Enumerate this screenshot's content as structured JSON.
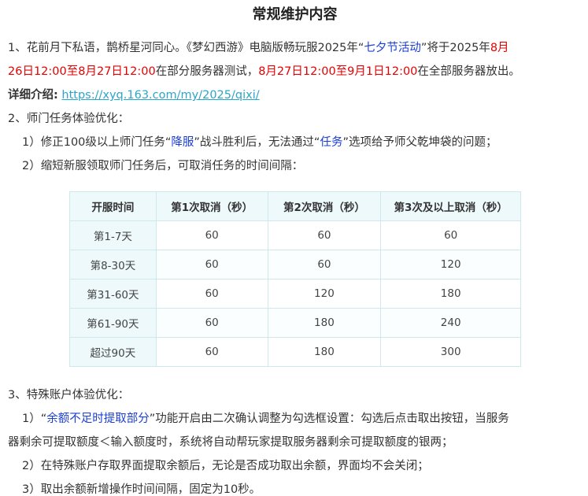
{
  "title": "常规维护内容",
  "item1": {
    "prefix": "1、花前月下私语，鹊桥星河同心。《梦幻西游》电脑版畅玩服2025年“",
    "event_name": "七夕节活动",
    "mid": "”将于2025年",
    "date1a": "8月",
    "date1b": "26日12:00至8月27日12:00",
    "mid2": "在部分服务器测试，",
    "date2": "8月27日12:00至9月1日12:00",
    "suffix": "在全部服务器放出。"
  },
  "detail": {
    "label": "详细介绍:",
    "url": "https://xyq.163.com/my/2025/qixi/"
  },
  "item2": {
    "heading": "2、师门任务体验优化：",
    "sub1_prefix": "1）修正100级以上师门任务“",
    "sub1_k1": "降服",
    "sub1_mid": "”战斗胜利后，无法通过“",
    "sub1_k2": "任务",
    "sub1_suffix": "”选项给予师父乾坤袋的问题；",
    "sub2": "2）缩短新服领取师门任务后，可取消任务的时间间隔："
  },
  "table": {
    "headers": [
      "开服时间",
      "第1次取消（秒）",
      "第2次取消（秒）",
      "第3次及以上取消（秒）"
    ],
    "rows": [
      [
        "第1-7天",
        "60",
        "60",
        "60"
      ],
      [
        "第8-30天",
        "60",
        "60",
        "120"
      ],
      [
        "第31-60天",
        "60",
        "120",
        "180"
      ],
      [
        "第61-90天",
        "60",
        "180",
        "240"
      ],
      [
        "超过90天",
        "60",
        "180",
        "300"
      ]
    ]
  },
  "item3": {
    "heading": "3、特殊账户体验优化：",
    "sub1_prefix": "1）“",
    "sub1_k": "余额不足时提取部分",
    "sub1_suffix": "”功能开启由二次确认调整为勾选框设置：勾选后点击取出按钮，当服务",
    "sub1_line2": "器剩余可提取额度＜输入额度时，系统将自动帮玩家提取服务器剩余可提取额度的银两；",
    "sub2": "2）在特殊账户存取界面提取余额后，无论是否成功取出余额，界面均不会关闭；",
    "sub3": "3）取出余额新增操作时间间隔，固定为10秒。"
  }
}
